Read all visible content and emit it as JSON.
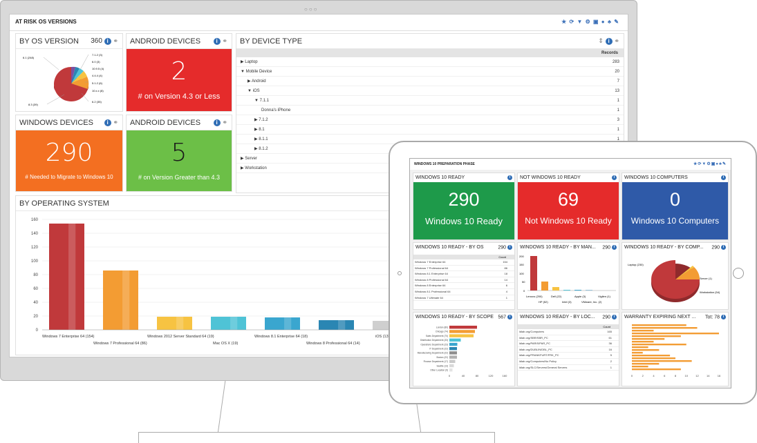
{
  "monitor": {
    "dashboard_title": "AT RISK OS VERSIONS",
    "by_os_version": {
      "title": "BY OS VERSION",
      "count": "360",
      "pie_labels_left": [
        "6.1 (248)",
        "8.3 (39)"
      ],
      "pie_labels_right": [
        "7.1.2 (3)",
        "6.0 (3)",
        "10.9.5 (4)",
        "4.4.4 (4)",
        "5.1.2 (6)",
        "10.x.x (8)",
        "6.2 (35)"
      ]
    },
    "android1": {
      "title": "ANDROID DEVICES",
      "value": "2",
      "caption": "# on Version 4.3 or Less",
      "color": "#e52b2b"
    },
    "windows": {
      "title": "WINDOWS DEVICES",
      "value": "290",
      "caption": "# Needed to Migrate to Windows 10",
      "color": "#f36f21"
    },
    "android2": {
      "title": "ANDROID DEVICES",
      "value": "5",
      "caption": "# on Version Greater than 4.3",
      "color": "#6cbf47"
    },
    "by_device_type": {
      "title": "BY DEVICE TYPE",
      "records_header": "Records",
      "rows": [
        {
          "label": "Laptop",
          "value": "283"
        },
        {
          "label": "Mobile Device",
          "value": "20"
        },
        {
          "label": "Android",
          "value": "7"
        },
        {
          "label": "iOS",
          "value": "13"
        },
        {
          "label": "7.1.1",
          "value": "1"
        },
        {
          "label": "Donna's iPhone",
          "value": "1"
        },
        {
          "label": "7.1.2",
          "value": "3"
        },
        {
          "label": "8.1",
          "value": "1"
        },
        {
          "label": "8.1.1",
          "value": "1"
        },
        {
          "label": "8.1.2",
          "value": "1"
        },
        {
          "label": "Server",
          "value": ""
        },
        {
          "label": "Workstation",
          "value": ""
        }
      ]
    },
    "by_operating_system": {
      "title": "BY OPERATING SYSTEM",
      "label_row1": [
        "Windows 7 Enterprise 64 (154)",
        "Windows 2012 Server Standard 64 (19)",
        "Windows 8.1 Enterprise 64 (18)",
        "iOS (13)"
      ],
      "label_row2": [
        "Windows 7 Professional 64 (86)",
        "Mac OS X (19)",
        "Windows 8 Professional 64 (14)"
      ]
    }
  },
  "chart_data": {
    "type": "bar",
    "title": "BY OPERATING SYSTEM",
    "categories": [
      "Windows 7 Enterprise 64",
      "Windows 7 Professional 64",
      "Windows 2012 Server Standard 64",
      "Mac OS X",
      "Windows 8.1 Enterprise 64",
      "Windows 8 Professional 64",
      "iOS"
    ],
    "values": [
      154,
      86,
      19,
      19,
      18,
      14,
      13
    ],
    "ylim": [
      0,
      160
    ],
    "yticks": [
      0,
      20,
      40,
      60,
      80,
      100,
      120,
      140,
      160
    ],
    "colors": [
      "#c0393b",
      "#f39c33",
      "#f7c342",
      "#4fc3d6",
      "#3aa6cf",
      "#2a86b3",
      "#cfcfcf"
    ],
    "grid": true
  },
  "tablet": {
    "dashboard_title": "WINDOWS 10 PREPARATION PHASE",
    "ready": {
      "title": "WINDOWS 10 READY",
      "value": "290",
      "caption": "Windows 10 Ready",
      "color": "#1e9a4a"
    },
    "not_ready": {
      "title": "NOT WINDOWS 10 READY",
      "value": "69",
      "caption": "Not Windows 10 Ready",
      "color": "#e52b2b"
    },
    "computers": {
      "title": "WINDOWS 10 COMPUTERS",
      "value": "0",
      "caption": "Windows 10 Computers",
      "color": "#2f5aa8"
    },
    "by_os": {
      "title": "WINDOWS 10 READY - BY OS",
      "count": "290",
      "header": "Count",
      "rows": [
        {
          "label": "Windows 7 Enterprise 64",
          "value": "154"
        },
        {
          "label": "Windows 7 Professional 64",
          "value": "86"
        },
        {
          "label": "Windows 8.1 Enterprise 64",
          "value": "18"
        },
        {
          "label": "Windows 8 Professional 64",
          "value": "14"
        },
        {
          "label": "Windows 8 Enterprise 64",
          "value": "6"
        },
        {
          "label": "Windows 8.1 Professional 64",
          "value": "4"
        },
        {
          "label": "Windows 7 Ultimate 64",
          "value": "1"
        }
      ]
    },
    "by_manufacturer": {
      "title": "WINDOWS 10 READY - BY MAN...",
      "count": "290",
      "yticks": [
        "200",
        "150",
        "100",
        "50",
        "0"
      ],
      "xlabels_top": [
        "Lenovo (200)",
        "Dell (22)",
        "Apple (3)",
        "Vigilen (1)"
      ],
      "xlabels_bottom": [
        "HP (52)",
        "Intel (3)",
        "VMware, Inc. (2)"
      ]
    },
    "by_computer": {
      "title": "WINDOWS 10 READY - BY COMP...",
      "count": "290",
      "labels": [
        "Laptop (230)",
        "Server (1)",
        "Workstation (54)"
      ]
    },
    "by_scope": {
      "title": "WINDOWS 10 READY - BY SCOPE",
      "count": "567",
      "labels": [
        "London (80)",
        "Chicago (74)",
        "Sales Department (70)",
        "Distribution Department (33)",
        "Operations Department (23)",
        "IT Department (22)",
        "Manufacturing Department (22)",
        "Boston (22)",
        "Finance Department (17)",
        "Seattle (13)",
        "Other Location (9)"
      ],
      "xticks": [
        "0",
        "40",
        "80",
        "120",
        "160"
      ]
    },
    "by_location": {
      "title": "WINDOWS 10 READY - BY LOC...",
      "count": "290",
      "header": "Count",
      "rows": [
        {
          "label": "ldlab.org/Computers",
          "value": "165"
        },
        {
          "label": "ldlab.org/SBR/SBR_PC",
          "value": "61"
        },
        {
          "label": "ldlab.org/PARIS/PAR_PC",
          "value": "36"
        },
        {
          "label": "ldlab.org/DUBLIN/DBL_PC",
          "value": "16"
        },
        {
          "label": "ldlab.org/FRANKFURT/FRK_PC",
          "value": "5"
        },
        {
          "label": "ldlab.org/Computers/No Policy",
          "value": "2"
        },
        {
          "label": "ldlab.org/SLC/Servers/General Servers",
          "value": "1"
        }
      ]
    },
    "warranty": {
      "title": "WARRANTY EXPIRING NEXT ...",
      "total_label": "Tot: 78",
      "xticks": [
        "0",
        "2",
        "4",
        "6",
        "8",
        "10",
        "12",
        "14",
        "16"
      ]
    }
  }
}
